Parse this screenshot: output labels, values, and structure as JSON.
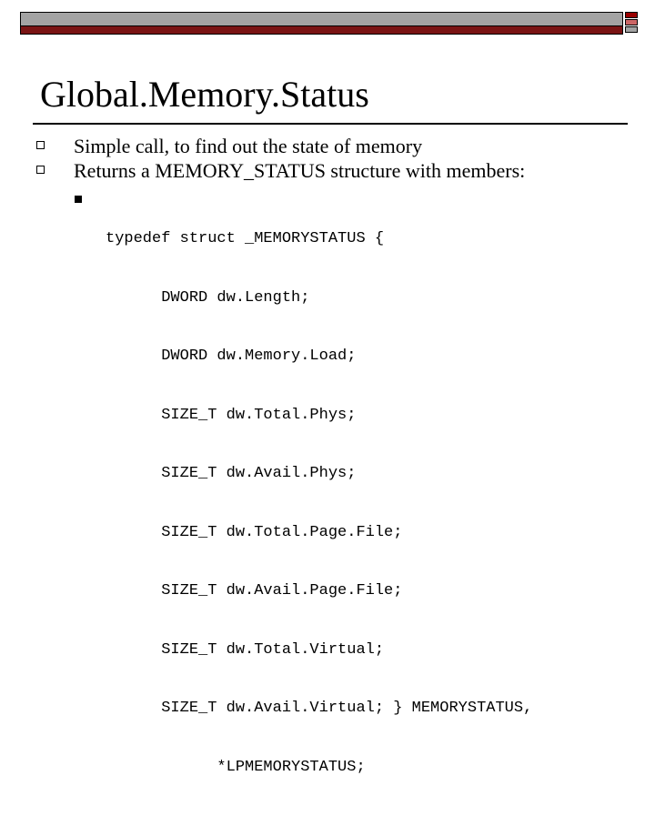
{
  "slide": {
    "title": "Global.Memory.Status",
    "bullets": [
      "Simple call, to find out the state of memory",
      "Returns a MEMORY_STATUS structure with members:"
    ],
    "code_lines": [
      "typedef struct _MEMORYSTATUS {",
      "      DWORD dw.Length;",
      "      DWORD dw.Memory.Load;",
      "      SIZE_T dw.Total.Phys;",
      "      SIZE_T dw.Avail.Phys;",
      "      SIZE_T dw.Total.Page.File;",
      "      SIZE_T dw.Avail.Page.File;",
      "      SIZE_T dw.Total.Virtual;",
      "      SIZE_T dw.Avail.Virtual; } MEMORYSTATUS,",
      "            *LPMEMORYSTATUS;"
    ]
  },
  "colors": {
    "band_gray": "#a3a3a3",
    "band_rose": "#cc6666",
    "band_dark_red": "#7a1414",
    "corner_red": "#990000"
  }
}
